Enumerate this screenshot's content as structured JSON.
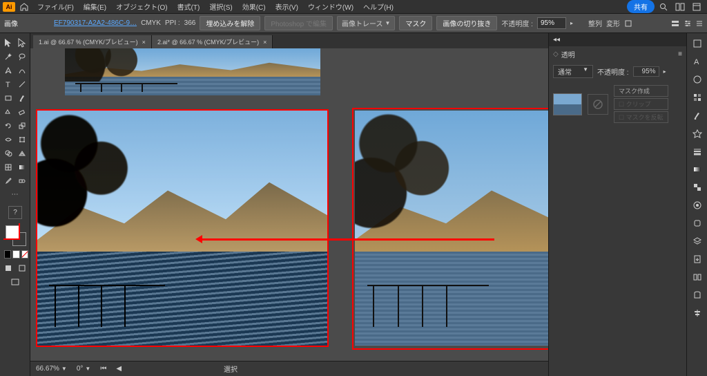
{
  "menubar": {
    "logo": "Ai",
    "items": [
      "ファイル(F)",
      "編集(E)",
      "オブジェクト(O)",
      "書式(T)",
      "選択(S)",
      "効果(C)",
      "表示(V)",
      "ウィンドウ(W)",
      "ヘルプ(H)"
    ],
    "share": "共有"
  },
  "controlbar": {
    "type_label": "画像",
    "filename": "EF790317-A2A2-486C-9…",
    "colormode": "CMYK",
    "ppi_label": "PPI :",
    "ppi_value": "366",
    "embed_btn": "埋め込みを解除",
    "ps_edit": "Photoshop で編集",
    "trace_label": "画像トレース",
    "mask_btn": "マスク",
    "crop_btn": "画像の切り抜き",
    "opacity_label": "不透明度 :",
    "opacity_value": "95%",
    "align_label": "整列",
    "transform_label": "変形"
  },
  "tabs": [
    {
      "label": "1.ai @ 66.67 % (CMYK/プレビュー)"
    },
    {
      "label": "2.ai* @ 66.67 % (CMYK/プレビュー)"
    }
  ],
  "transparency_panel": {
    "tab": "透明",
    "blend_mode": "通常",
    "opacity_label": "不透明度 :",
    "opacity_value": "95%",
    "make_mask": "マスク作成",
    "clip": "クリップ",
    "invert": "マスクを反転"
  },
  "statusbar": {
    "zoom": "66.67%",
    "rotation": "0°",
    "tool_label": "選択"
  },
  "tools": [
    [
      "selection",
      "direct-selection"
    ],
    [
      "magic-wand",
      "lasso"
    ],
    [
      "pen",
      "curvature"
    ],
    [
      "type",
      "line-segment"
    ],
    [
      "rectangle",
      "paintbrush"
    ],
    [
      "shaper",
      "eraser"
    ],
    [
      "rotate",
      "scale"
    ],
    [
      "width",
      "free-transform"
    ],
    [
      "shape-builder",
      "perspective"
    ],
    [
      "mesh",
      "gradient"
    ],
    [
      "eyedropper",
      "blend"
    ],
    [
      "symbol-sprayer",
      "column-graph"
    ],
    [
      "artboard",
      "slice"
    ],
    [
      "hand",
      "zoom"
    ]
  ],
  "right_strip_icons": [
    "properties",
    "layers",
    "libraries",
    "color",
    "swatches",
    "brushes",
    "symbols",
    "stroke",
    "gradient",
    "transparency",
    "appearance",
    "graphic-styles",
    "align",
    "pathfinder",
    "transform",
    "actions"
  ]
}
